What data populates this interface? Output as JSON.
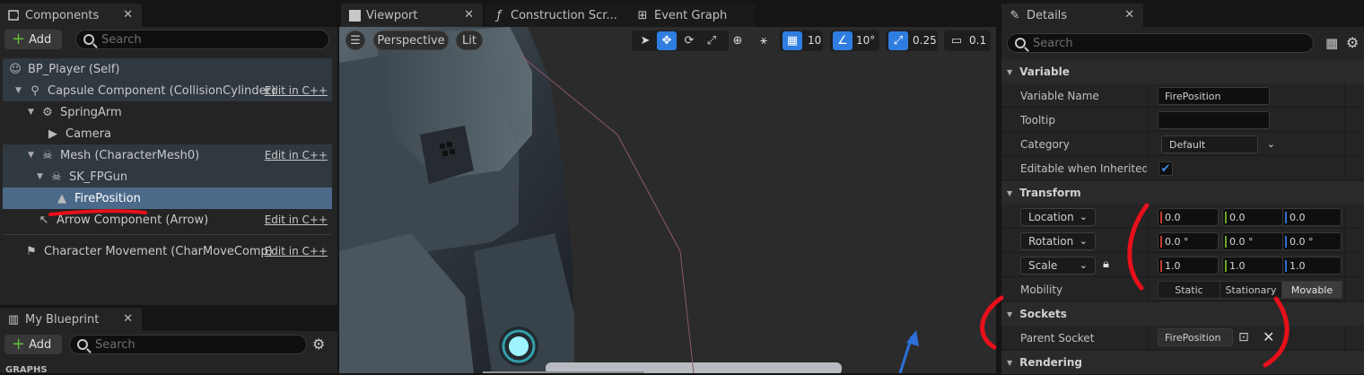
{
  "components_panel": {
    "tab_title": "Components",
    "add_label": "Add",
    "search_placeholder": "Search",
    "items": [
      {
        "label": "BP_Player (Self)"
      },
      {
        "label": "Capsule Component (CollisionCylinder)",
        "edit": "Edit in C++"
      },
      {
        "label": "SpringArm"
      },
      {
        "label": "Camera"
      },
      {
        "label": "Mesh (CharacterMesh0)",
        "edit": "Edit in C++"
      },
      {
        "label": "SK_FPGun"
      },
      {
        "label": "FirePosition"
      },
      {
        "label": "Arrow Component (Arrow)",
        "edit": "Edit in C++"
      },
      {
        "label": "Character Movement (CharMoveComp)",
        "edit": "Edit in C++"
      }
    ]
  },
  "my_blueprint": {
    "tab_title": "My Blueprint",
    "add_label": "Add",
    "search_placeholder": "Search",
    "section_label": "GRAPHS"
  },
  "editor_tabs": {
    "viewport": "Viewport",
    "construction": "Construction Scr...",
    "event_graph": "Event Graph"
  },
  "viewport_toolbar": {
    "perspective": "Perspective",
    "lit": "Lit",
    "grid_snap": "10",
    "rotation_snap": "10°",
    "scale_snap": "0.25",
    "camera_speed": "0.1"
  },
  "details": {
    "tab_title": "Details",
    "search_placeholder": "Search",
    "sections": {
      "variable": "Variable",
      "transform": "Transform",
      "sockets": "Sockets",
      "rendering": "Rendering"
    },
    "variable": {
      "name_label": "Variable Name",
      "name_value": "FirePosition",
      "tooltip_label": "Tooltip",
      "tooltip_value": "",
      "category_label": "Category",
      "category_value": "Default",
      "editable_label": "Editable when Inherited",
      "editable_checked": true
    },
    "transform": {
      "location_label": "Location",
      "location": [
        "0.0",
        "0.0",
        "0.0"
      ],
      "rotation_label": "Rotation",
      "rotation": [
        "0.0 °",
        "0.0 °",
        "0.0 °"
      ],
      "scale_label": "Scale",
      "scale": [
        "1.0",
        "1.0",
        "1.0"
      ],
      "mobility_label": "Mobility",
      "mobility_options": [
        "Static",
        "Stationary",
        "Movable"
      ],
      "mobility_selected": "Movable"
    },
    "sockets": {
      "parent_socket_label": "Parent Socket",
      "parent_socket_value": "FirePosition"
    }
  },
  "colors": {
    "selection": "#4b6a8a",
    "accent_blue": "#2f7de1",
    "annotation_red": "#e8101a"
  }
}
